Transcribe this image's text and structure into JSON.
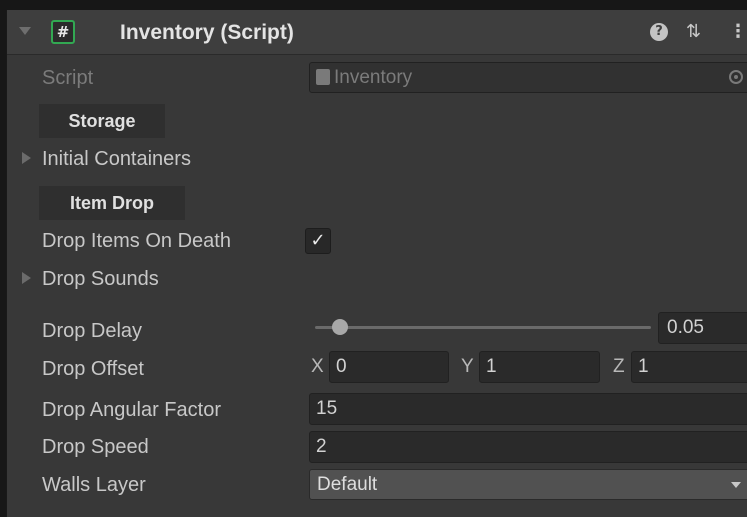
{
  "header": {
    "title": "Inventory (Script)",
    "script_icon_glyph": "#",
    "icons": [
      "help-icon",
      "presets-icon",
      "kebab-menu-icon"
    ]
  },
  "script_field": {
    "label": "Script",
    "value": "Inventory"
  },
  "sections": {
    "storage": "Storage",
    "item_drop": "Item Drop"
  },
  "initial_containers": {
    "label": "Initial Containers"
  },
  "drop_items_on_death": {
    "label": "Drop Items On Death",
    "checked": true,
    "check_glyph": "✓"
  },
  "drop_sounds": {
    "label": "Drop Sounds"
  },
  "drop_delay": {
    "label": "Drop Delay",
    "value": "0.05",
    "slider_fraction": 0.05
  },
  "drop_offset": {
    "label": "Drop Offset",
    "x_label": "X",
    "x": "0",
    "y_label": "Y",
    "y": "1",
    "z_label": "Z",
    "z": "1"
  },
  "drop_angular_factor": {
    "label": "Drop Angular Factor",
    "value": "15"
  },
  "drop_speed": {
    "label": "Drop Speed",
    "value": "2"
  },
  "walls_layer": {
    "label": "Walls Layer",
    "value": "Default"
  },
  "colors": {
    "background": "#383838",
    "header": "#3e3e3e",
    "field": "#2a2a2a",
    "text": "#c8c8c8",
    "script_icon_accent": "#32a852"
  }
}
